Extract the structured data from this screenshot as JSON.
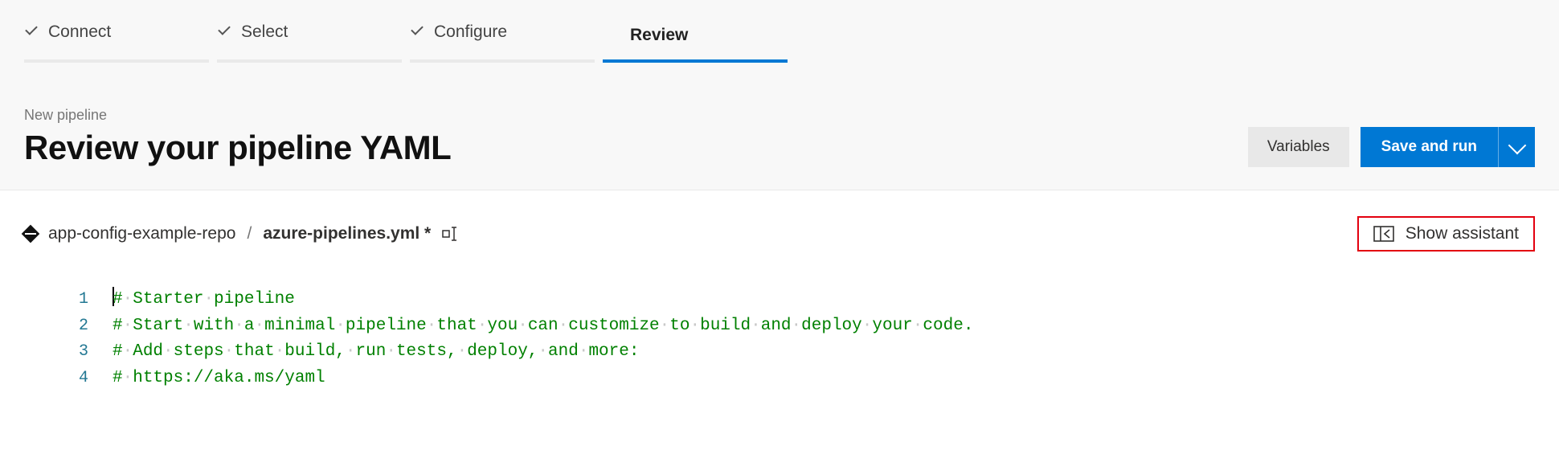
{
  "steps": [
    {
      "label": "Connect",
      "done": true,
      "active": false
    },
    {
      "label": "Select",
      "done": true,
      "active": false
    },
    {
      "label": "Configure",
      "done": true,
      "active": false
    },
    {
      "label": "Review",
      "done": false,
      "active": true
    }
  ],
  "preTitle": "New pipeline",
  "title": "Review your pipeline YAML",
  "buttons": {
    "variables": "Variables",
    "saveRun": "Save and run"
  },
  "breadcrumb": {
    "repo": "app-config-example-repo",
    "sep": "/",
    "file": "azure-pipelines.yml *"
  },
  "assistant": {
    "label": "Show assistant"
  },
  "codeLines": [
    {
      "num": "1",
      "words": [
        "#",
        "Starter",
        "pipeline"
      ],
      "hasCursor": true
    },
    {
      "num": "2",
      "words": [
        "#",
        "Start",
        "with",
        "a",
        "minimal",
        "pipeline",
        "that",
        "you",
        "can",
        "customize",
        "to",
        "build",
        "and",
        "deploy",
        "your",
        "code."
      ]
    },
    {
      "num": "3",
      "words": [
        "#",
        "Add",
        "steps",
        "that",
        "build,",
        "run",
        "tests,",
        "deploy,",
        "and",
        "more:"
      ]
    },
    {
      "num": "4",
      "words": [
        "#",
        "https://aka.ms/yaml"
      ]
    }
  ]
}
